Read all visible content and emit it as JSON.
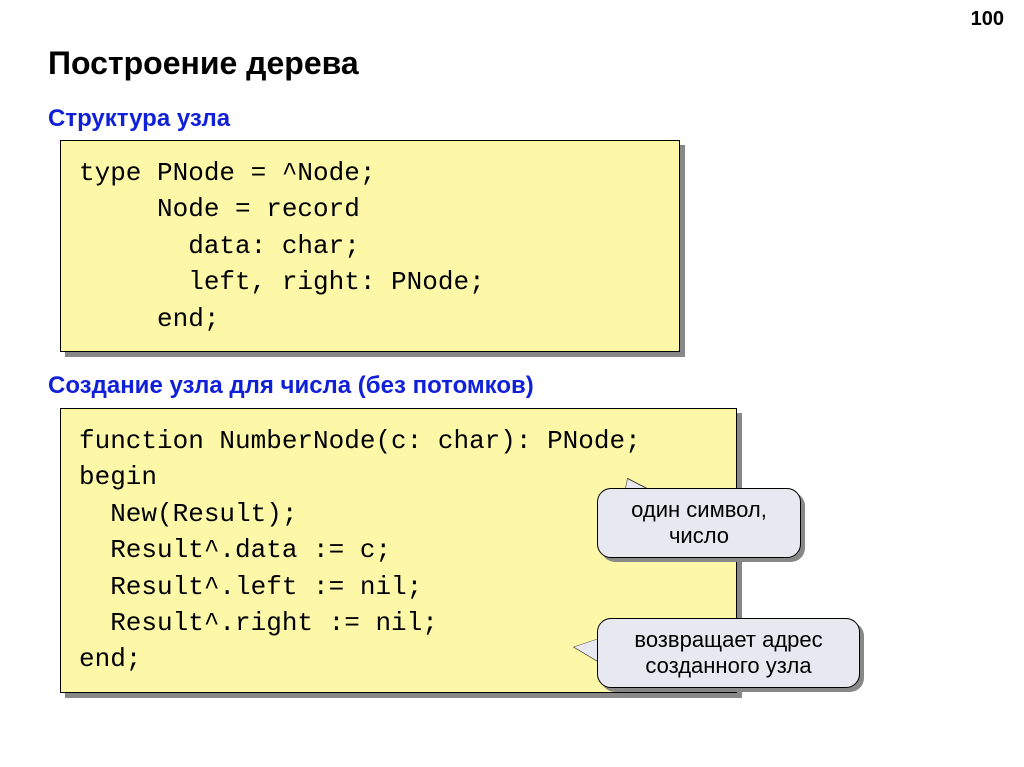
{
  "page_number": "100",
  "title": "Построение дерева",
  "sections": {
    "structure": {
      "heading": "Структура узла",
      "code": "type PNode = ^Node;\n     Node = record\n       data: char;\n       left, right: PNode;\n     end;"
    },
    "create": {
      "heading": "Создание узла для числа (без потомков)",
      "code": "function NumberNode(c: char): PNode;\nbegin\n  New(Result);\n  Result^.data := c;\n  Result^.left := nil;\n  Result^.right := nil;\nend;"
    }
  },
  "callouts": {
    "one_symbol": "один символ,\nчисло",
    "returns_addr": "возвращает адрес\nсозданного узла"
  }
}
